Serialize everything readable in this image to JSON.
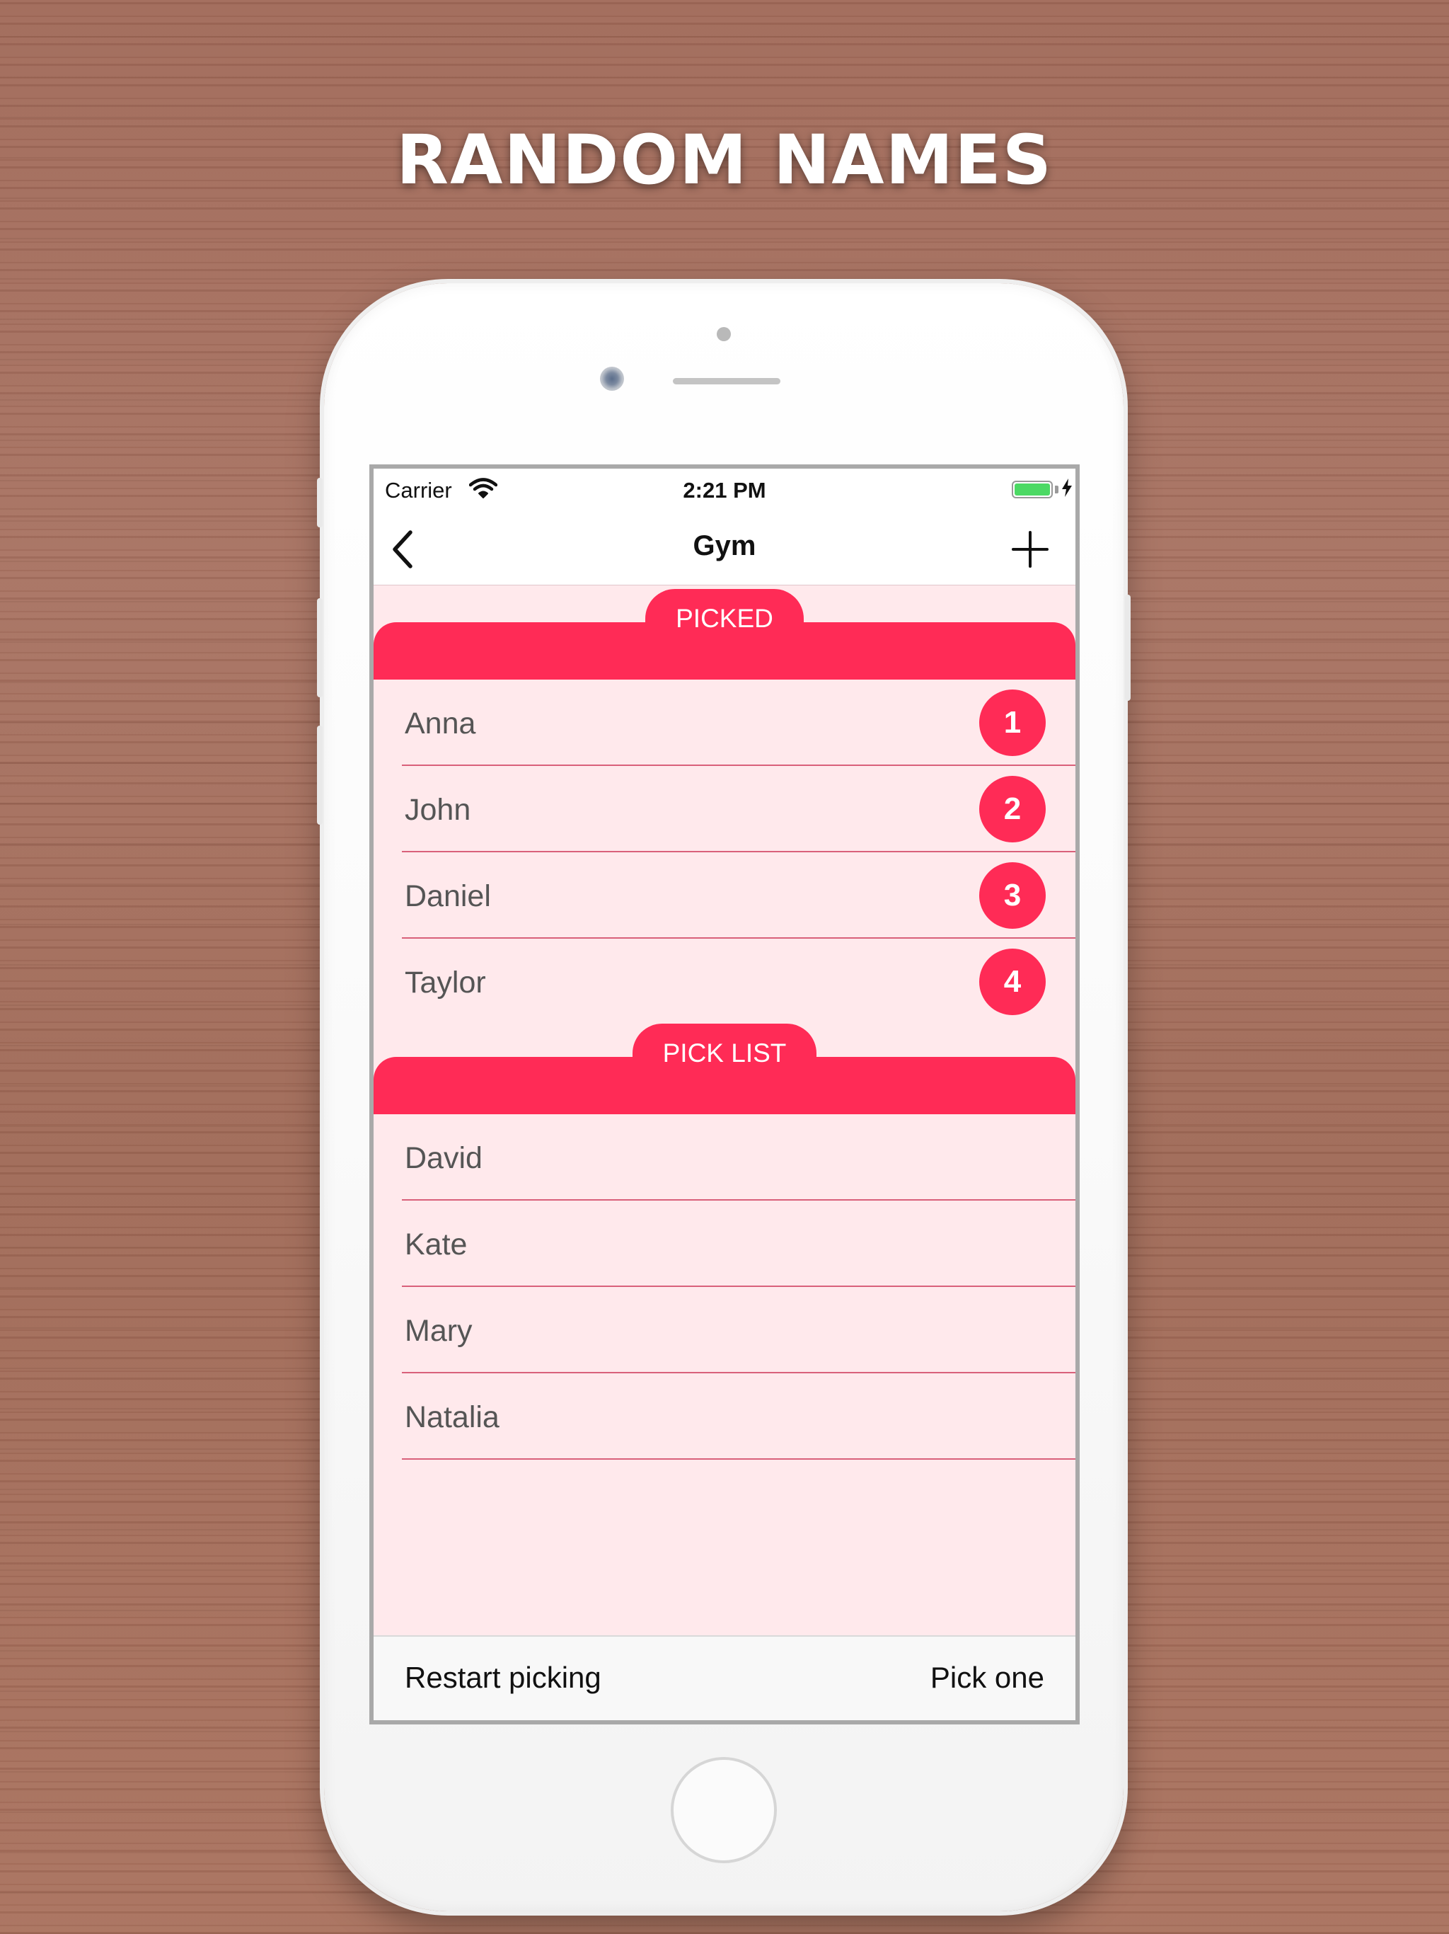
{
  "headline": "RANDOM NAMES",
  "status_bar": {
    "carrier": "Carrier",
    "time": "2:21 PM",
    "battery_level": 1.0,
    "icons": [
      "wifi-icon",
      "battery-icon",
      "charging-bolt-icon"
    ]
  },
  "nav": {
    "title": "Gym",
    "back_icon": "chevron-left-icon",
    "add_icon": "plus-icon"
  },
  "picked": {
    "title": "PICKED",
    "items": [
      {
        "name": "Anna",
        "order": "1"
      },
      {
        "name": "John",
        "order": "2"
      },
      {
        "name": "Daniel",
        "order": "3"
      },
      {
        "name": "Taylor",
        "order": "4"
      }
    ]
  },
  "pick_list": {
    "title": "PICK LIST",
    "items": [
      {
        "name": "David"
      },
      {
        "name": "Kate"
      },
      {
        "name": "Mary"
      },
      {
        "name": "Natalia"
      }
    ]
  },
  "toolbar": {
    "restart_label": "Restart picking",
    "pick_label": "Pick one"
  },
  "colors": {
    "accent": "#ff2b56",
    "list_background": "#ffe9ec",
    "divider": "#d9607a",
    "battery": "#4cd964"
  }
}
